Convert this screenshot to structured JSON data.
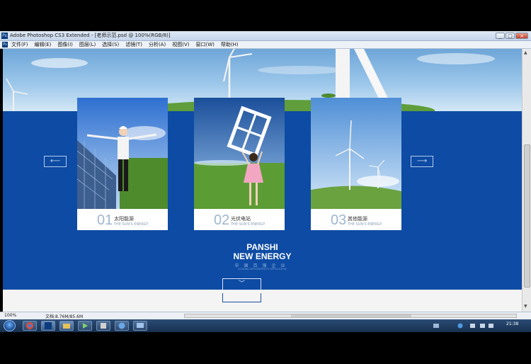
{
  "window": {
    "title": "Adobe Photoshop CS3 Extended - [老师示范.psd @ 100%(RGB/8)]",
    "app_icon": "Ps",
    "buttons": [
      "_",
      "□",
      "×"
    ]
  },
  "menu": {
    "items": [
      "文件(F)",
      "编辑(E)",
      "图像(I)",
      "图层(L)",
      "选择(S)",
      "滤镜(T)",
      "分析(A)",
      "视图(V)",
      "窗口(W)",
      "帮助(H)"
    ]
  },
  "canvas": {
    "cards": [
      {
        "num": "01",
        "cn": "太阳能源",
        "en": "THE SUN'S ENERGY"
      },
      {
        "num": "02",
        "cn": "光伏电站",
        "en": "THE SUN'S ENERGY"
      },
      {
        "num": "03",
        "cn": "其他能源",
        "en": "THE SUN'S ENERGY"
      }
    ],
    "prev_arrow": "⟵",
    "next_arrow": "⟶",
    "brand": {
      "line1": "PANSHI",
      "line2": "NEW ENERGY",
      "cn": "中国百强企业",
      "tagline": "LEADING INTEGRATED PV APPLICATION"
    },
    "down_arrow": "﹀",
    "colors": {
      "primary_blue": "#0d4ba4",
      "sky": "#9cc7ea",
      "grass": "#5f9e3a"
    }
  },
  "status": {
    "zoom": "100%",
    "doc": "文档:8.76M/85.6M"
  },
  "taskbar": {
    "clock": "21:38",
    "apps": [
      "chrome-icon",
      "photoshop-icon",
      "folder-icon",
      "media-icon",
      "app-icon",
      "help-icon",
      "screen-icon"
    ]
  }
}
